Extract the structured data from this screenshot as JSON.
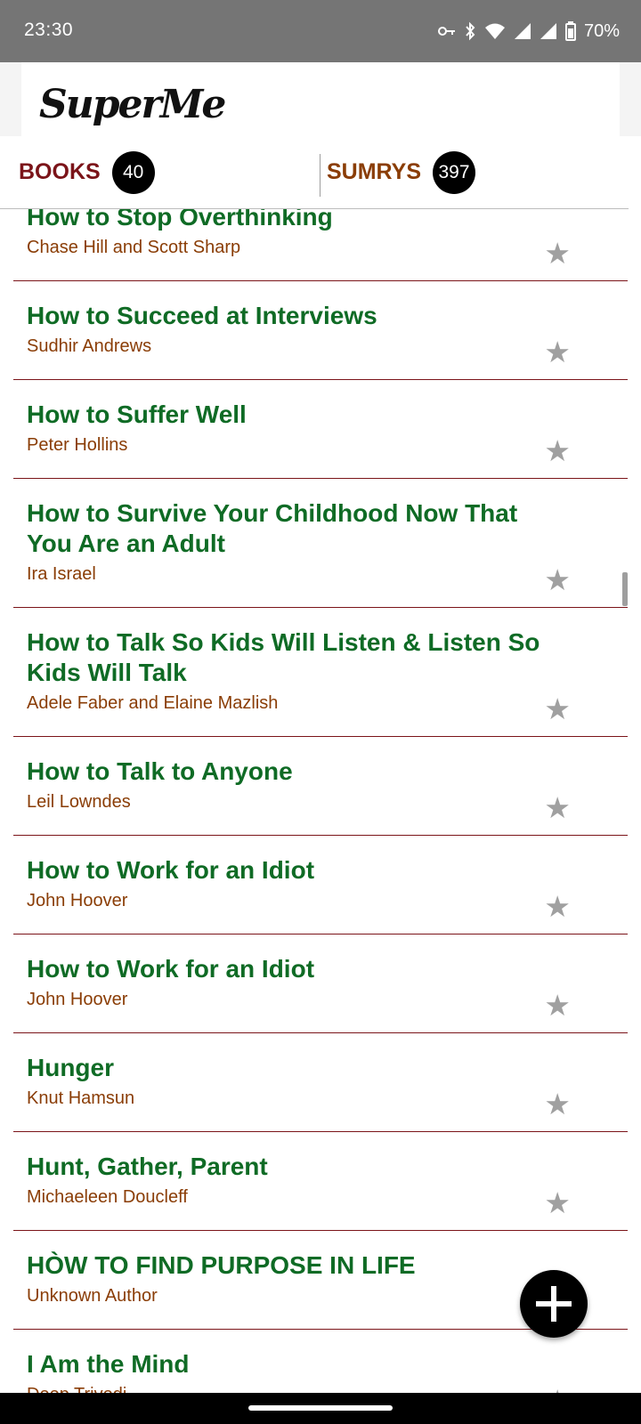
{
  "status_bar": {
    "time": "23:30",
    "battery": "70%",
    "icons": [
      "vpn-key-icon",
      "bluetooth-icon",
      "wifi-icon",
      "signal-icon",
      "signal-icon",
      "battery-icon"
    ]
  },
  "header": {
    "logo": "SuperMe"
  },
  "tabs": [
    {
      "label": "BOOKS",
      "count": "40",
      "color": "#7b1419"
    },
    {
      "label": "SUMRYS",
      "count": "397",
      "color": "#8a3d06"
    }
  ],
  "books": [
    {
      "title": "How to Stop Overthinking",
      "author": "Chase Hill and Scott Sharp"
    },
    {
      "title": "How to Succeed at Interviews",
      "author": "Sudhir Andrews"
    },
    {
      "title": "How to Suffer Well",
      "author": "Peter Hollins"
    },
    {
      "title": "How to Survive Your Childhood Now That You Are an Adult",
      "author": "Ira Israel"
    },
    {
      "title": "How to Talk So Kids Will Listen & Listen So Kids Will Talk",
      "author": "Adele Faber and Elaine Mazlish"
    },
    {
      "title": "How to Talk to Anyone",
      "author": "Leil Lowndes"
    },
    {
      "title": "How to Work for an Idiot",
      "author": "John Hoover"
    },
    {
      "title": "How to Work for an Idiot",
      "author": "John Hoover"
    },
    {
      "title": "Hunger",
      "author": "Knut Hamsun"
    },
    {
      "title": "Hunt, Gather, Parent",
      "author": "Michaeleen Doucleff"
    },
    {
      "title": "HÒW TO FIND PURPOSE IN LIFE",
      "author": "Unknown Author"
    },
    {
      "title": "I Am the Mind",
      "author": "Deep Trivedi"
    }
  ],
  "star_icon": "★",
  "fab": {
    "icon": "plus-icon"
  },
  "colors": {
    "title": "#0f6b25",
    "author": "#8a3d06",
    "divider": "#7b1419",
    "star": "#a0a0a0",
    "status_bar": "#757575"
  }
}
